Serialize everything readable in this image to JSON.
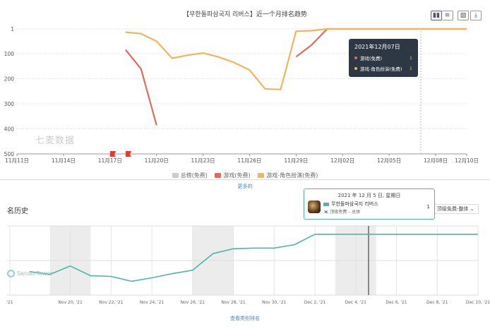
{
  "top": {
    "title": "【무한돌파삼국지 리버스】近一个月排名趋势",
    "watermark": "七麦数据",
    "more_link": "更多的",
    "tools": [
      "bar-chart-icon",
      "list-icon",
      "image-download-icon",
      "download-icon"
    ],
    "tooltip": {
      "date": "2021年12月07日",
      "rows": [
        {
          "name": "游戏(免费)",
          "value": "1",
          "color": "#e06c5c"
        },
        {
          "name": "游戏-角色扮演(免费)",
          "value": "1",
          "color": "#f2b55a"
        }
      ]
    }
  },
  "bottom": {
    "section_title": "名历史",
    "select_value": "顶级免费-整体",
    "more_link": "查看类别排名",
    "logo": "SensorTower",
    "tooltip": {
      "date": "2021 年 12 月 5 日, 星期日",
      "app_name": "무한돌파삼국지 리버스",
      "category": "顶级免费 – 总体",
      "value": "1"
    }
  },
  "chart_data": [
    {
      "type": "line",
      "title": "【무한돌파삼국지 리버스】近一个月排名趋势",
      "y_reversed": true,
      "ylim": [
        1,
        500
      ],
      "y_ticks": [
        1,
        100,
        200,
        300,
        400,
        500
      ],
      "x_ticks": [
        "11月11日",
        "11月14日",
        "11月17日",
        "11月20日",
        "11月23日",
        "11月26日",
        "11月29日",
        "12月02日",
        "12月05日",
        "12月08日",
        "12月10日"
      ],
      "legend": [
        "总榜(免费)",
        "游戏(免费)",
        "游戏-角色扮演(免费)"
      ],
      "legend_colors": [
        "#cccccc",
        "#e06c5c",
        "#f2b55a"
      ],
      "series": [
        {
          "name": "游戏(免费)",
          "color": "#e06c5c",
          "segments": [
            [
              [
                "2021-11-18",
                84
              ],
              [
                "2021-11-19",
                160
              ],
              [
                "2021-11-20",
                385
              ]
            ],
            [
              [
                "2021-11-29",
                112
              ],
              [
                "2021-11-30",
                65
              ],
              [
                "2021-12-01",
                1
              ],
              [
                "2021-12-10",
                1
              ]
            ]
          ]
        },
        {
          "name": "游戏-角色扮演(免费)",
          "color": "#f2b55a",
          "segments": [
            [
              [
                "2021-11-18",
                14
              ],
              [
                "2021-11-19",
                20
              ],
              [
                "2021-11-20",
                50
              ],
              [
                "2021-11-21",
                118
              ],
              [
                "2021-11-22",
                106
              ],
              [
                "2021-11-23",
                97
              ],
              [
                "2021-11-24",
                113
              ],
              [
                "2021-11-25",
                135
              ],
              [
                "2021-11-26",
                165
              ],
              [
                "2021-11-27",
                240
              ],
              [
                "2021-11-28",
                243
              ],
              [
                "2021-11-29",
                10
              ],
              [
                "2021-11-30",
                8
              ],
              [
                "2021-12-01",
                1
              ],
              [
                "2021-12-10",
                1
              ]
            ]
          ]
        }
      ]
    },
    {
      "type": "line",
      "x_ticks": [
        "'21",
        "Nov 20, '21",
        "Nov 22, '21",
        "Nov 24, '21",
        "Nov 26, '21",
        "Nov 28, '21",
        "Nov 30, '21",
        "Dec 2, '21",
        "Dec 4, '21",
        "Dec 6, '21",
        "Dec 8, '21",
        "Dec 10, '21"
      ],
      "series": [
        {
          "name": "무한돌파삼국지 리버스",
          "color": "#4fb5a8",
          "values": [
            [
              "2021-11-18",
              0.34
            ],
            [
              "2021-11-19",
              0.3
            ],
            [
              "2021-11-20",
              0.42
            ],
            [
              "2021-11-21",
              0.28
            ],
            [
              "2021-11-22",
              0.27
            ],
            [
              "2021-11-23",
              0.2
            ],
            [
              "2021-11-24",
              0.25
            ],
            [
              "2021-11-25",
              0.31
            ],
            [
              "2021-11-26",
              0.36
            ],
            [
              "2021-11-27",
              0.6
            ],
            [
              "2021-11-28",
              0.67
            ],
            [
              "2021-11-29",
              0.68
            ],
            [
              "2021-11-30",
              0.68
            ],
            [
              "2021-12-01",
              0.73
            ],
            [
              "2021-12-02",
              0.88
            ],
            [
              "2021-12-10",
              0.88
            ]
          ]
        }
      ]
    }
  ]
}
